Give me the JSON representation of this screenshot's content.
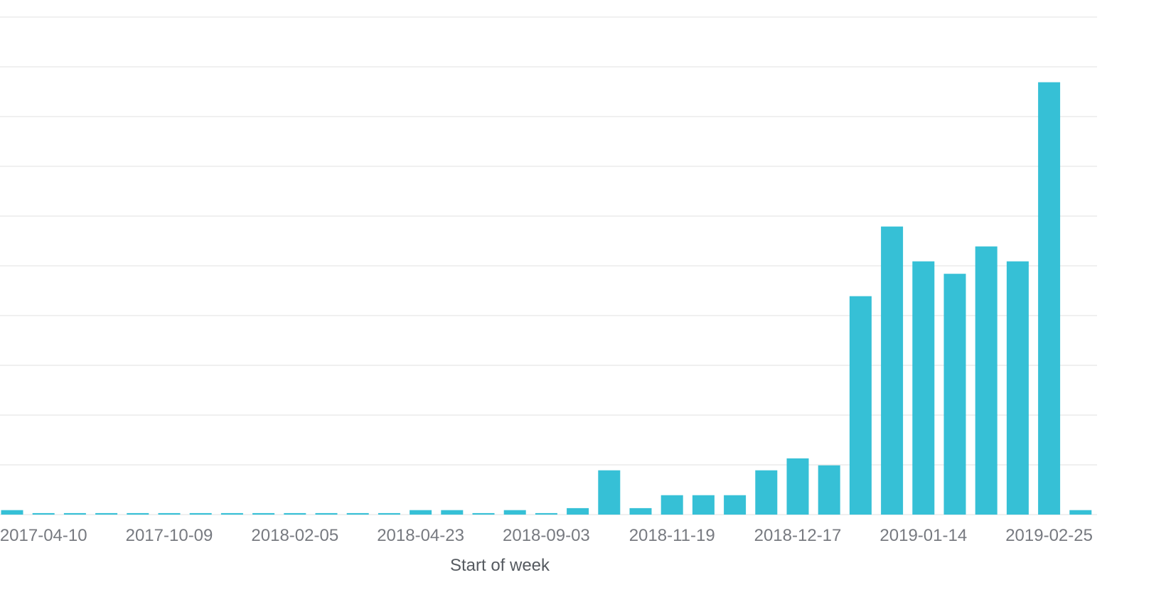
{
  "chart_data": {
    "type": "bar",
    "title": "",
    "xlabel": "Start of week",
    "ylabel": "",
    "ylim": [
      0,
      10
    ],
    "grid": true,
    "bar_color": "#36c0d6",
    "categories": [
      "",
      "2017-04-10",
      "",
      "",
      "",
      "2017-10-09",
      "",
      "",
      "",
      "2018-02-05",
      "",
      "",
      "",
      "2018-04-23",
      "",
      "",
      "",
      "2018-09-03",
      "",
      "",
      "",
      "2018-11-19",
      "",
      "",
      "",
      "2018-12-17",
      "",
      "",
      "",
      "2019-01-14",
      "",
      "",
      "",
      "2019-02-25",
      ""
    ],
    "values": [
      0.09,
      0.03,
      0.03,
      0.03,
      0.03,
      0.03,
      0.03,
      0.03,
      0.03,
      0.03,
      0.03,
      0.03,
      0.03,
      0.09,
      0.09,
      0.03,
      0.09,
      0.03,
      0.13,
      0.89,
      0.13,
      0.39,
      0.39,
      0.39,
      0.89,
      1.13,
      0.99,
      4.39,
      5.79,
      5.09,
      4.84,
      5.39,
      5.09,
      8.69,
      0.09
    ]
  }
}
